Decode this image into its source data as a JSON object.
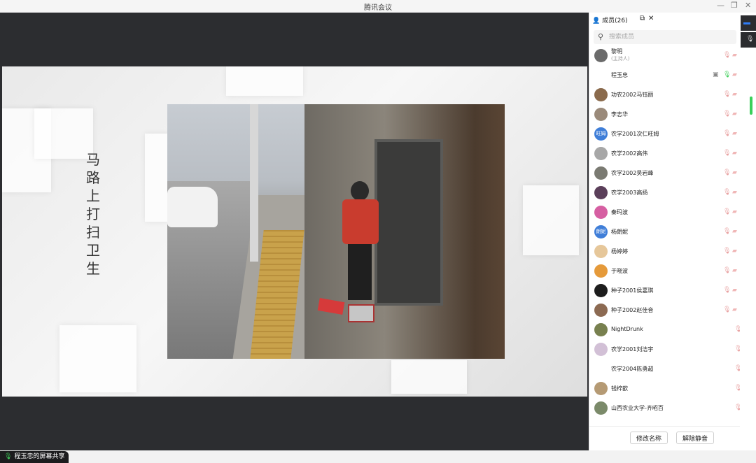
{
  "window": {
    "title": "腾讯会议",
    "minimize_glyph": "—",
    "restore_glyph": "❐",
    "close_glyph": "✕"
  },
  "share": {
    "slide_vertical_text": "马路上打扫卫生",
    "status_text": "程玉忠的屏幕共享",
    "status_icon": "mic-icon"
  },
  "panel": {
    "title": "成员(26)",
    "popout_glyph": "⧉",
    "close_glyph": "✕",
    "search_placeholder": "搜索成员",
    "members": [
      {
        "name": "黎明",
        "role": "(主持人)",
        "avatar": "",
        "avatar_color": "#6b6b6b"
      },
      {
        "name": "程玉忠",
        "avatar": "",
        "avatar_color": "#ffffff",
        "sharing": true,
        "mic_on": true
      },
      {
        "name": "功农2002马钰丽",
        "avatar": "",
        "avatar_color": "#8a6a4c"
      },
      {
        "name": "李志华",
        "avatar": "",
        "avatar_color": "#9a8a7a"
      },
      {
        "name": "农学2001次仁旺姆",
        "avatar": "旺姆",
        "avatar_color": "#3f7ed8"
      },
      {
        "name": "农学2002高伟",
        "avatar": "",
        "avatar_color": "#a7a7a7"
      },
      {
        "name": "农学2002吴岩峰",
        "avatar": "",
        "avatar_color": "#7a7a72"
      },
      {
        "name": "农学2003高扬",
        "avatar": "",
        "avatar_color": "#5b3f5a"
      },
      {
        "name": "秦玛波",
        "avatar": "",
        "avatar_color": "#d65fa2"
      },
      {
        "name": "杨朗妮",
        "avatar": "朗妮",
        "avatar_color": "#3f7ed8"
      },
      {
        "name": "杨婷婷",
        "avatar": "",
        "avatar_color": "#e6c79a"
      },
      {
        "name": "于晓波",
        "avatar": "",
        "avatar_color": "#e59a3a"
      },
      {
        "name": "种子2001侯嘉琪",
        "avatar": "",
        "avatar_color": "#1d1d1d"
      },
      {
        "name": "种子2002赵佳音",
        "avatar": "",
        "avatar_color": "#8c6a52"
      },
      {
        "name": "NightDrunk",
        "avatar": "",
        "avatar_color": "#78804f",
        "solo_mic": true
      },
      {
        "name": "农学2001刘洁宇",
        "avatar": "",
        "avatar_color": "#d2c0d6",
        "solo_mic": true
      },
      {
        "name": "农学2004陈勇超",
        "avatar": "",
        "avatar_color": "#ffffff",
        "solo_mic": true
      },
      {
        "name": "钱梓歆",
        "avatar": "",
        "avatar_color": "#b59a74",
        "solo_mic": true
      },
      {
        "name": "山西农业大学-齐昭百",
        "avatar": "",
        "avatar_color": "#7b8a6a",
        "solo_mic": true
      }
    ],
    "rename_button": "修改名称",
    "unmute_button": "解除静音"
  }
}
